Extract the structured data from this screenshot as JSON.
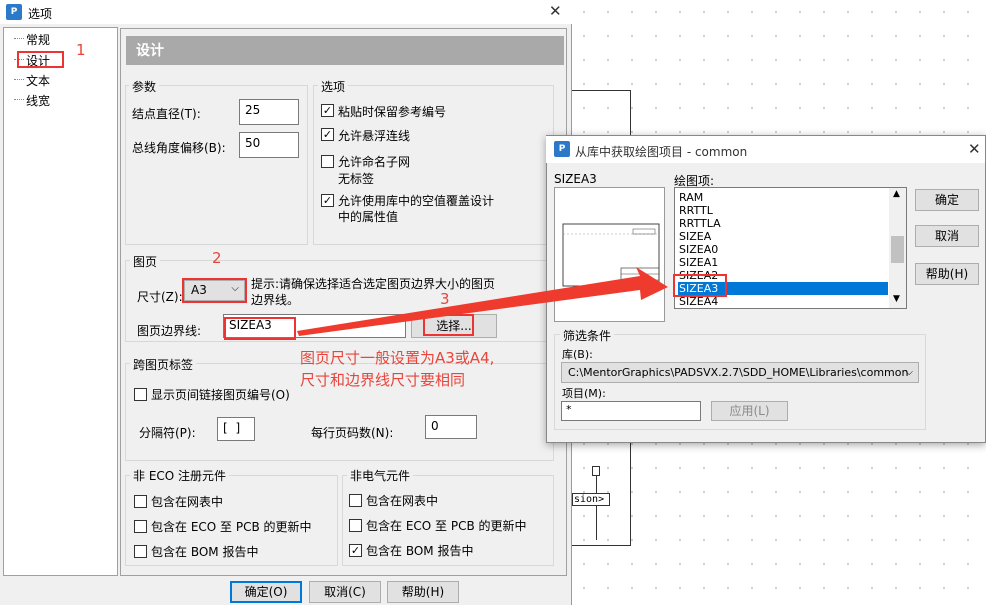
{
  "main_dialog": {
    "title": "选项",
    "app_icon_text": "P",
    "tree": [
      "常规",
      "设计",
      "文本",
      "线宽"
    ],
    "panel_title": "设计",
    "params": {
      "title": "参数",
      "node_diameter_label": "结点直径(T):",
      "node_diameter_value": "25",
      "bus_angle_label": "总线角度偏移(B):",
      "bus_angle_value": "50"
    },
    "options": {
      "title": "选项",
      "items": [
        {
          "label": "粘贴时保留参考编号",
          "checked": true
        },
        {
          "label": "允许悬浮连线",
          "checked": true
        },
        {
          "label": "允许命名子网",
          "label2": "无标签",
          "checked": false
        },
        {
          "label": "允许使用库中的空值覆盖设计",
          "label2": "中的属性值",
          "checked": true
        }
      ]
    },
    "page": {
      "title": "图页",
      "size_label": "尺寸(Z):",
      "size_value": "A3",
      "hint_line1": "提示:请确保选择适合选定图页边界大小的图页",
      "hint_line2": "边界线。",
      "border_label": "图页边界线:",
      "border_value": "SIZEA3",
      "select_button": "选择..."
    },
    "cross_page": {
      "title": "跨图页标签",
      "show_links_label": "显示页间链接图页编号(O)",
      "show_links_checked": false,
      "separator_label": "分隔符(P):",
      "separator_value": "[ ]",
      "per_line_label": "每行页码数(N):",
      "per_line_value": "0"
    },
    "non_eco": {
      "title": "非 ECO 注册元件",
      "items": [
        {
          "label": "包含在网表中",
          "checked": false
        },
        {
          "label": "包含在 ECO 至 PCB 的更新中",
          "checked": false
        },
        {
          "label": "包含在 BOM 报告中",
          "checked": false
        }
      ]
    },
    "non_electrical": {
      "title": "非电气元件",
      "items": [
        {
          "label": "包含在网表中",
          "checked": false
        },
        {
          "label": "包含在 ECO 至 PCB 的更新中",
          "checked": false
        },
        {
          "label": "包含在 BOM 报告中",
          "checked": true
        }
      ]
    },
    "buttons": {
      "ok": "确定(O)",
      "cancel": "取消(C)",
      "help": "帮助(H)"
    }
  },
  "library_dialog": {
    "title": "从库中获取绘图项目 - common",
    "preview_label": "SIZEA3",
    "list_label": "绘图项:",
    "list_items": [
      "RAM",
      "RRTTL",
      "RRTTLA",
      "SIZEA",
      "SIZEA0",
      "SIZEA1",
      "SIZEA2",
      "SIZEA3",
      "SIZEA4"
    ],
    "selected_item": "SIZEA3",
    "buttons": {
      "ok": "确定",
      "cancel": "取消",
      "help": "帮助(H)"
    },
    "filter": {
      "title": "筛选条件",
      "library_label": "库(B):",
      "library_value": "C:\\MentorGraphics\\PADSVX.2.7\\SDD_HOME\\Libraries\\common",
      "item_label": "项目(M):",
      "item_value": "*",
      "apply_button": "应用(L)"
    }
  },
  "annotations": {
    "n1": "1",
    "n2": "2",
    "n3": "3",
    "note_line1": "图页尺寸一般设置为A3或A4,",
    "note_line2": "尺寸和边界线尺寸要相同",
    "color": "#e8453c"
  },
  "canvas_fragment": "sion>"
}
